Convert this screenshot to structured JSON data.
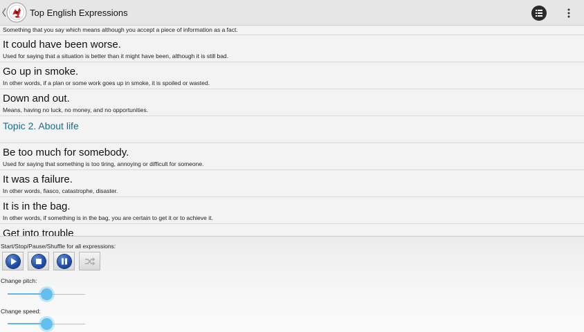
{
  "app": {
    "title": "Top English Expressions"
  },
  "toolbar": {
    "list_icon": "list-icon",
    "overflow_icon": "more-vertical-icon"
  },
  "list": {
    "partial_top_meaning": "Something that you say which means although you accept a piece of information as a fact.",
    "items_before_topic": [
      {
        "phrase": "It could have been worse.",
        "meaning": "Used for saying that a situation is better than it might have been, although it is still bad."
      },
      {
        "phrase": "Go up in smoke.",
        "meaning": "In other words, if a plan or some work goes up in smoke, it is spoiled or wasted."
      },
      {
        "phrase": "Down and out.",
        "meaning": "Means, having no luck, no money, and no opportunities."
      }
    ],
    "topic_title": "Topic 2. About life",
    "items_after_topic": [
      {
        "phrase": "Be too much for somebody.",
        "meaning": "Used for saying that something is too tiring, annoying or difficult for someone."
      },
      {
        "phrase": "It was a failure.",
        "meaning": "In other words, fiasco, catastrophe, disaster."
      },
      {
        "phrase": "It is in the bag.",
        "meaning": "In other words, if something is in the bag, you are certain to get it or to achieve it."
      }
    ],
    "partial_bottom_phrase": "Get into trouble"
  },
  "controls": {
    "playback_label": "Start/Stop/Pause/Shuffle for all expressions:",
    "buttons": [
      {
        "name": "play",
        "icon": "play-icon"
      },
      {
        "name": "stop",
        "icon": "stop-icon"
      },
      {
        "name": "pause",
        "icon": "pause-icon"
      },
      {
        "name": "shuffle",
        "icon": "shuffle-icon",
        "disabled": true
      }
    ],
    "pitch_label": "Change pitch:",
    "pitch_value": 0.5,
    "speed_label": "Change speed:",
    "speed_value": 0.5,
    "accent_color": "#63c0ee"
  }
}
